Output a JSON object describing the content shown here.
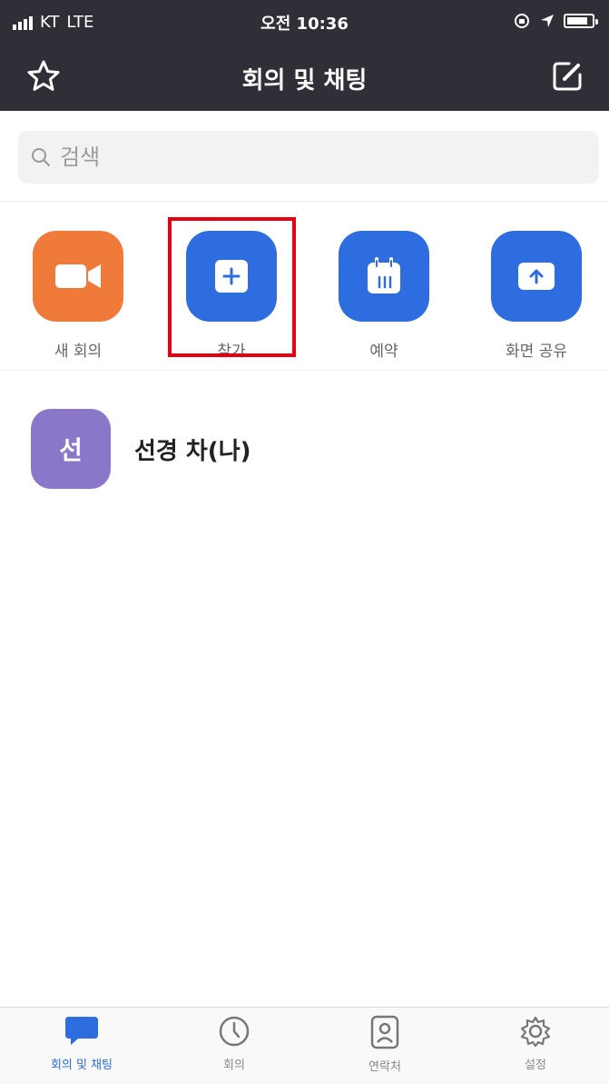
{
  "status": {
    "carrier": "KT",
    "network": "LTE",
    "time": "오전 10:36"
  },
  "nav": {
    "title": "회의 및 채팅"
  },
  "search": {
    "placeholder": "검색"
  },
  "actions": [
    {
      "label": "새 회의",
      "color": "#f07a3a",
      "icon": "video-camera-icon"
    },
    {
      "label": "참가",
      "color": "#2d6de0",
      "icon": "plus-icon"
    },
    {
      "label": "예약",
      "color": "#2d6de0",
      "icon": "calendar-icon"
    },
    {
      "label": "화면 공유",
      "color": "#2d6de0",
      "icon": "share-screen-icon"
    }
  ],
  "contact": {
    "avatar_text": "선",
    "name": "선경 차(나)",
    "avatar_color": "#8b77c9"
  },
  "tabs": [
    {
      "label": "회의 및 채팅",
      "icon": "chat-bubble-icon",
      "active": true
    },
    {
      "label": "회의",
      "icon": "clock-icon",
      "active": false
    },
    {
      "label": "연락처",
      "icon": "contacts-icon",
      "active": false
    },
    {
      "label": "설정",
      "icon": "gear-icon",
      "active": false
    }
  ],
  "colors": {
    "header_bg": "#2f2f37",
    "accent": "#2d6de0",
    "highlight": "#e60012"
  }
}
